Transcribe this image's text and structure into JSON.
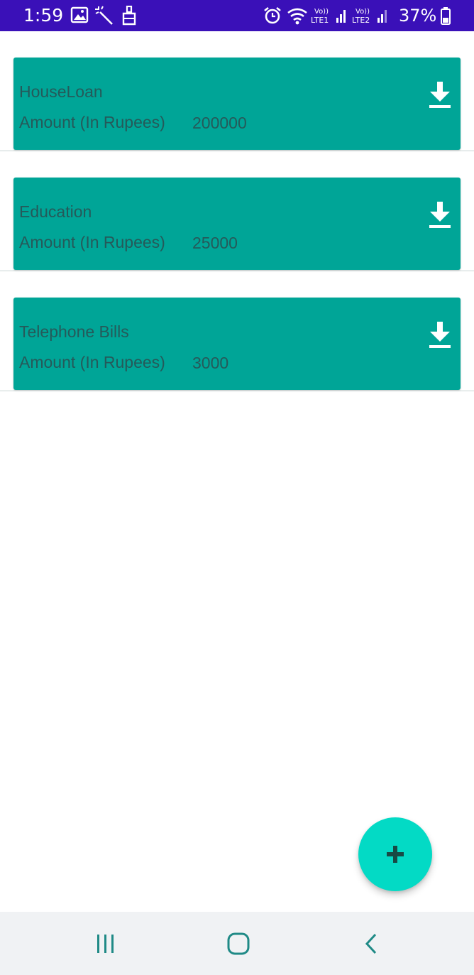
{
  "status_bar": {
    "time": "1:59",
    "battery": "37%",
    "left_icons": [
      "gallery-icon",
      "magic-wand-icon",
      "cleaner-icon"
    ],
    "right_icons": [
      "alarm-icon",
      "wifi-icon",
      "volte-lte1-signal-icon",
      "volte-lte2-signal-icon",
      "battery-icon"
    ],
    "sim1_label": "LTE1",
    "sim2_label": "LTE2",
    "volte_label": "Vo))"
  },
  "list": {
    "items": [
      {
        "title": "HouseLoan",
        "amount_label": "Amount (In Rupees)",
        "amount": "200000"
      },
      {
        "title": "Education",
        "amount_label": "Amount (In Rupees)",
        "amount": "25000"
      },
      {
        "title": "Telephone Bills",
        "amount_label": "Amount (In Rupees)",
        "amount": "3000"
      }
    ]
  },
  "fab": {
    "icon": "plus-icon"
  },
  "nav_bar": {
    "buttons": [
      "recents-icon",
      "home-icon",
      "back-icon"
    ]
  },
  "colors": {
    "status_bar": "#3a10b8",
    "card": "#00a597",
    "card_text": "#255a5a",
    "fab": "#03dac5",
    "nav_bar": "#f0f2f4",
    "nav_icon": "#1f8a86"
  }
}
